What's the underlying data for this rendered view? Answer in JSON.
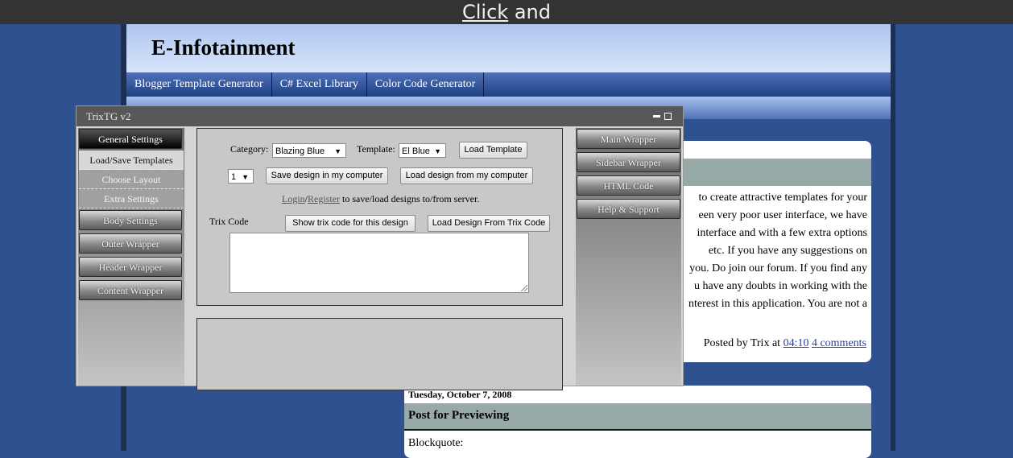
{
  "overlay_banner": {
    "click": "Click",
    "rest": "and"
  },
  "blog": {
    "title": "E-Infotainment",
    "nav": [
      "Blogger Template Generator",
      "C# Excel Library",
      "Color Code Generator"
    ]
  },
  "post1": {
    "lines": [
      "to create attractive templates for your",
      "een very poor user interface, we have",
      "interface and with a few extra options",
      "etc. If you have any suggestions on",
      "you. Do join our forum. If you find any",
      "u have any doubts in working with the",
      "nterest in this application. You are not a"
    ],
    "posted_by": "Posted by Trix at",
    "time": "04:10",
    "comments": "4 comments"
  },
  "post2": {
    "date": "Tuesday, October 7, 2008",
    "title": "Post for Previewing",
    "quote_label": "Blockquote:"
  },
  "trix": {
    "window_title": "TrixTG v2",
    "left_menu": {
      "general": "General Settings",
      "load_save": "Load/Save Templates",
      "choose_layout": "Choose Layout",
      "extra": "Extra Settings",
      "body": "Body Settings",
      "outer": "Outer Wrapper",
      "header": "Header Wrapper",
      "content": "Content Wrapper"
    },
    "right_menu": [
      "Main Wrapper",
      "Sidebar Wrapper",
      "HTML Code",
      "Help & Support"
    ],
    "category_label": "Category:",
    "category_value": "Blazing Blue",
    "template_label": "Template:",
    "template_value": "El Blue",
    "load_template": "Load Template",
    "slot_value": "1",
    "save_computer": "Save design in my computer",
    "load_computer": "Load design from my computer",
    "login": "Login",
    "slash": "/",
    "register": "Register",
    "server_text": "to save/load designs to/from server.",
    "trix_code_label": "Trix Code",
    "show_trix": "Show trix code for this design",
    "load_trix": "Load Design From Trix Code"
  },
  "colors": {
    "page_bg": "#2f5190",
    "topbar": "#333333",
    "window_title": "#585858",
    "post_title_band": "#98aaa8"
  }
}
